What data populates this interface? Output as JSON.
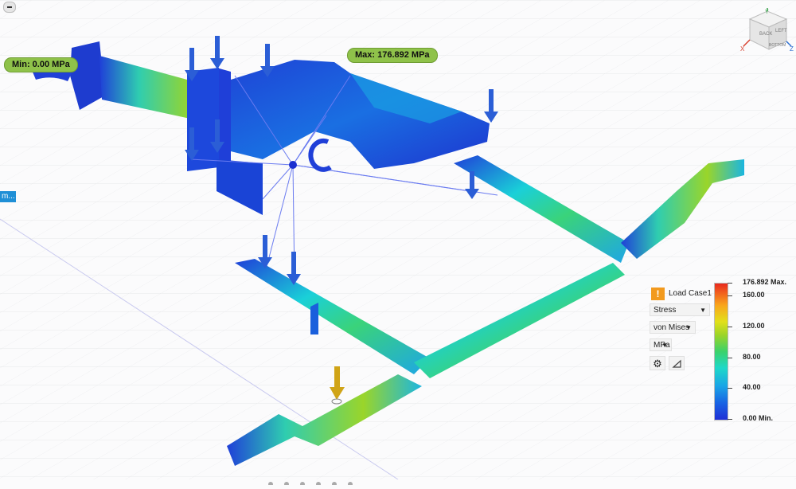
{
  "callouts": {
    "min": "Min: 0.00 MPa",
    "max": "Max: 176.892 MPa"
  },
  "left_tab": "m...",
  "nav_cube": {
    "faces": [
      "BACK",
      "LEFT",
      "BOTTOM"
    ],
    "axes": [
      "X",
      "Y",
      "Z"
    ],
    "colors": {
      "x": "#d8412f",
      "y": "#3aa14b",
      "z": "#2d6fd1"
    }
  },
  "legend_panel": {
    "warning_icon": "!",
    "load_case": "Load Case1",
    "result_type": "Stress",
    "component": "von Mises",
    "units": "MPa",
    "icons": [
      "gear-icon",
      "legend-options-icon"
    ]
  },
  "colorbar": {
    "labels": [
      "176.892 Max.",
      "160.00",
      "120.00",
      "80.00",
      "40.00",
      "0.00 Min."
    ],
    "values": [
      176.892,
      160,
      120,
      80,
      40,
      0
    ],
    "range": [
      0,
      176.892
    ]
  },
  "colors": {
    "callout_bg": "#8fc24a",
    "accent_blue": "#1f8fd6",
    "warning": "#f29a1e",
    "part_blue": "#1f3fd8",
    "load_arrow": "#2b5ed6",
    "gravity_arrow": "#d0a417"
  }
}
